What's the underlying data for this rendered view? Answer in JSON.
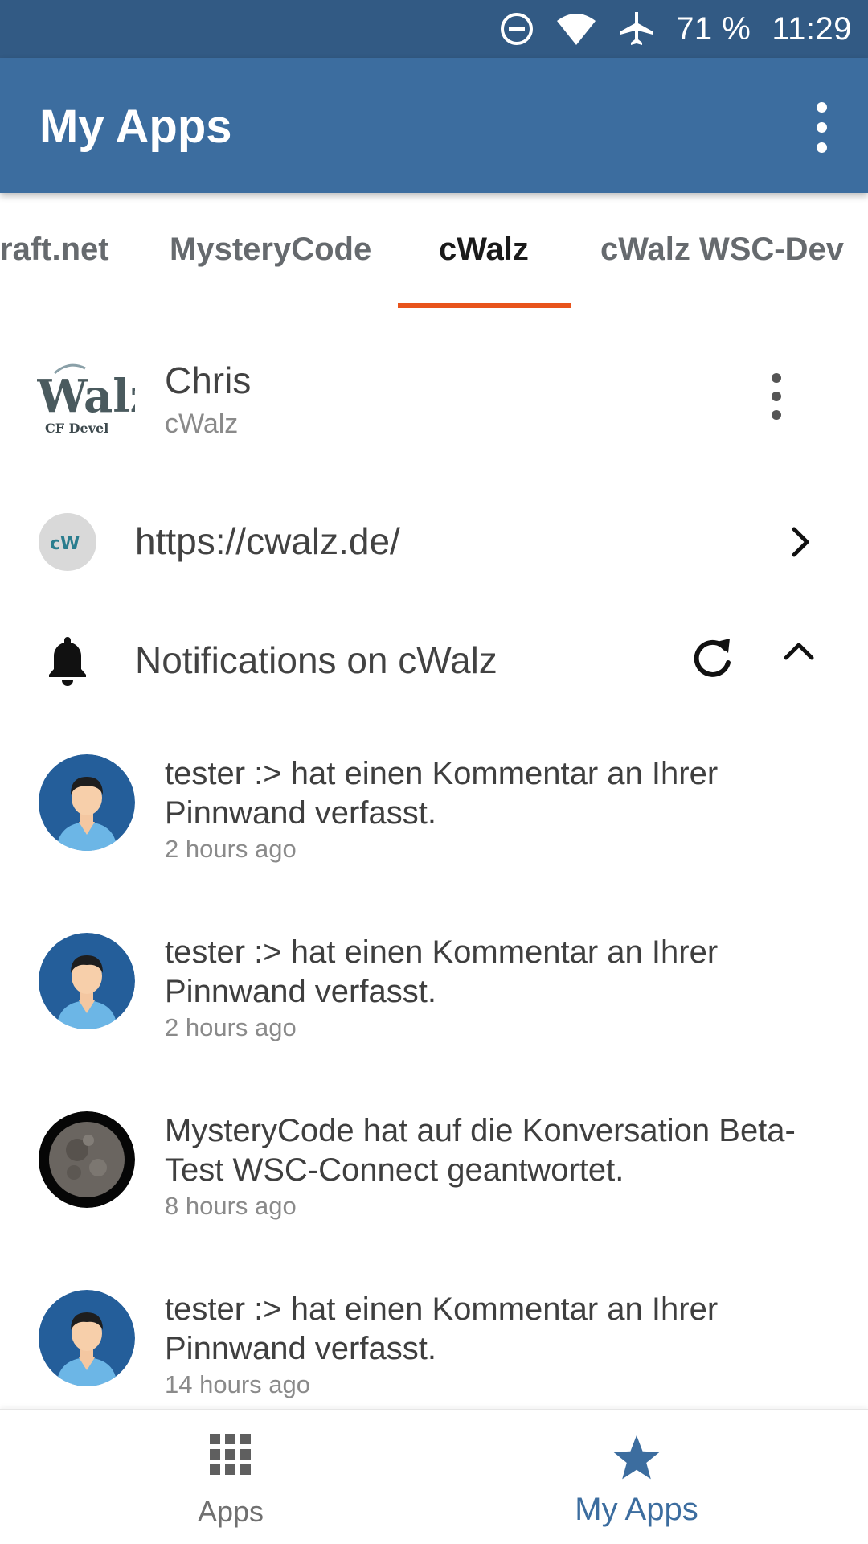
{
  "status_bar": {
    "battery": "71 %",
    "time": "11:29",
    "icons": [
      "do-not-disturb-icon",
      "wifi-icon",
      "airplane-icon"
    ]
  },
  "app_bar": {
    "title": "My Apps",
    "menu_icon": "more-vert-icon"
  },
  "tabs": [
    {
      "label": "raft.net"
    },
    {
      "label": "MysteryCode"
    },
    {
      "label": "cWalz",
      "active": true
    },
    {
      "label": "cWalz WSC-Dev"
    }
  ],
  "profile": {
    "name": "Chris",
    "app": "cWalz",
    "logo_text": "Walz",
    "logo_subtext": "CF Devel"
  },
  "site": {
    "icon_text": "cW",
    "url": "https://cwalz.de/"
  },
  "notifications": {
    "title": "Notifications on cWalz",
    "items": [
      {
        "text": "tester :> hat einen Kommentar an Ihrer Pinnwand verfasst.",
        "time": "2 hours ago",
        "avatar": "user-avatar"
      },
      {
        "text": "tester :> hat einen Kommentar an Ihrer Pinnwand verfasst.",
        "time": "2 hours ago",
        "avatar": "user-avatar"
      },
      {
        "text": "MysteryCode hat auf die Konversation Beta-Test WSC-Connect geantwortet.",
        "time": "8 hours ago",
        "avatar": "moon-avatar"
      },
      {
        "text": "tester :> hat einen Kommentar an Ihrer Pinnwand verfasst.",
        "time": "14 hours ago",
        "avatar": "user-avatar"
      }
    ]
  },
  "bottom_nav": {
    "apps_label": "Apps",
    "myapps_label": "My Apps"
  },
  "colors": {
    "status_bar": "#325a84",
    "app_bar": "#3c6d9f",
    "tab_indicator": "#e8541c",
    "accent": "#3c6d9f"
  }
}
